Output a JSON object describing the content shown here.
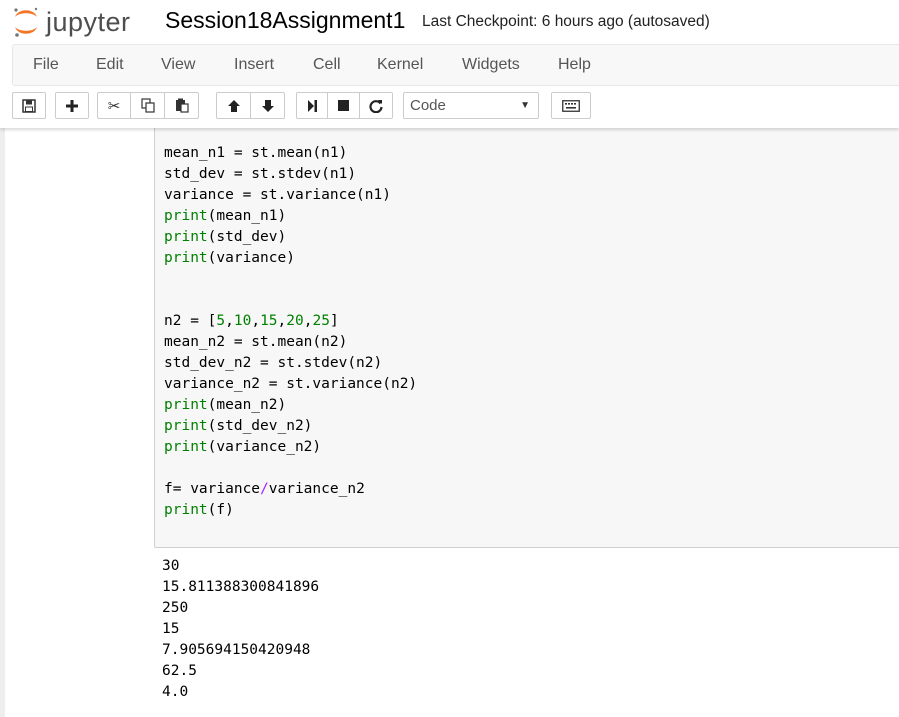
{
  "header": {
    "logo_text": "jupyter",
    "notebook_name": "Session18Assignment1",
    "checkpoint": "Last Checkpoint: 6 hours ago (autosaved)"
  },
  "menubar": {
    "items": [
      "File",
      "Edit",
      "View",
      "Insert",
      "Cell",
      "Kernel",
      "Widgets",
      "Help"
    ]
  },
  "toolbar": {
    "cell_type": "Code",
    "icons": [
      "save-icon",
      "plus-icon",
      "cut-icon",
      "copy-icon",
      "paste-icon",
      "arrow-up-icon",
      "arrow-down-icon",
      "step-forward-icon",
      "stop-icon",
      "restart-icon",
      "keyboard-icon"
    ]
  },
  "cell": {
    "code_lines": [
      [
        {
          "t": "mean_n1 = st.mean(n1)"
        }
      ],
      [
        {
          "t": "std_dev = st.stdev(n1)"
        }
      ],
      [
        {
          "t": "variance = st.variance(n1)"
        }
      ],
      [
        {
          "t": "print",
          "c": "kw"
        },
        {
          "t": "(mean_n1)"
        }
      ],
      [
        {
          "t": "print",
          "c": "kw"
        },
        {
          "t": "(std_dev)"
        }
      ],
      [
        {
          "t": "print",
          "c": "kw"
        },
        {
          "t": "(variance)"
        }
      ],
      [
        {
          "t": ""
        }
      ],
      [
        {
          "t": ""
        }
      ],
      [
        {
          "t": "n2 = ["
        },
        {
          "t": "5",
          "c": "num"
        },
        {
          "t": ","
        },
        {
          "t": "10",
          "c": "num"
        },
        {
          "t": ","
        },
        {
          "t": "15",
          "c": "num"
        },
        {
          "t": ","
        },
        {
          "t": "20",
          "c": "num"
        },
        {
          "t": ","
        },
        {
          "t": "25",
          "c": "num"
        },
        {
          "t": "]"
        }
      ],
      [
        {
          "t": "mean_n2 = st.mean(n2)"
        }
      ],
      [
        {
          "t": "std_dev_n2 = st.stdev(n2)"
        }
      ],
      [
        {
          "t": "variance_n2 = st.variance(n2)"
        }
      ],
      [
        {
          "t": "print",
          "c": "kw"
        },
        {
          "t": "(mean_n2)"
        }
      ],
      [
        {
          "t": "print",
          "c": "kw"
        },
        {
          "t": "(std_dev_n2)"
        }
      ],
      [
        {
          "t": "print",
          "c": "kw"
        },
        {
          "t": "(variance_n2)"
        }
      ],
      [
        {
          "t": ""
        }
      ],
      [
        {
          "t": "f= variance"
        },
        {
          "t": "/",
          "c": "op"
        },
        {
          "t": "variance_n2"
        }
      ],
      [
        {
          "t": "print",
          "c": "kw"
        },
        {
          "t": "(f)"
        }
      ]
    ],
    "output_lines": [
      "30",
      "15.811388300841896",
      "250",
      "15",
      "7.905694150420948",
      "62.5",
      "4.0"
    ]
  },
  "colors": {
    "keyword": "#008000",
    "operator": "#aa22ff",
    "logo_orange": "#f37626"
  }
}
